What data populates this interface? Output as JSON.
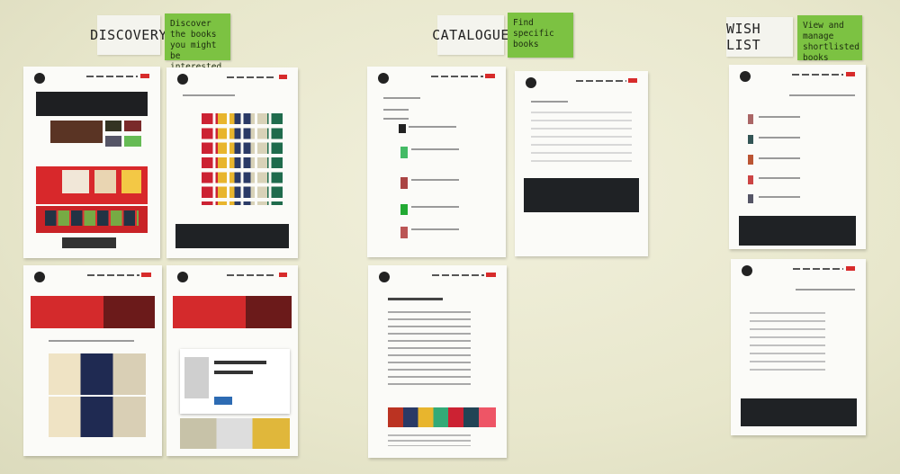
{
  "sections": [
    {
      "title": "DISCOVERY",
      "note": "Discover the books you might be interested in"
    },
    {
      "title": "CATALOGUE",
      "note": "Find specific books"
    },
    {
      "title": "WISH LIST",
      "note": "View and manage shortlisted books"
    }
  ],
  "colors": {
    "sticky": "#7cc242",
    "brand_red": "#d72b2b",
    "footer_dark": "#1f2225"
  }
}
